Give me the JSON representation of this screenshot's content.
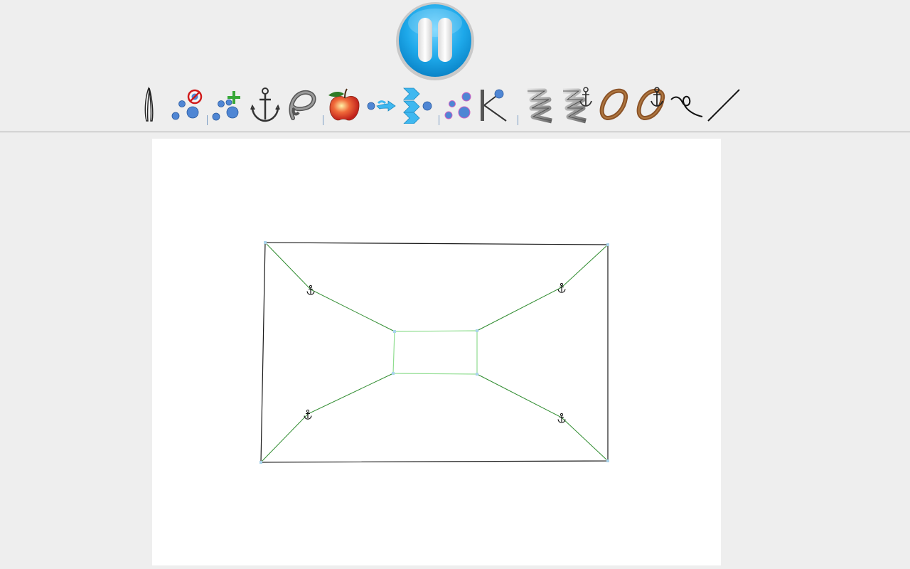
{
  "app": {
    "pause_button": {
      "icon": "pause-icon",
      "state": "running"
    }
  },
  "toolbar": {
    "tools": [
      {
        "id": "tweezers",
        "icon": "tweezers-icon"
      },
      {
        "id": "delete-atom",
        "icon": "delete-atom-icon"
      },
      {
        "id": "add-atom",
        "icon": "add-atom-icon"
      },
      {
        "id": "anchor",
        "icon": "anchor-icon"
      },
      {
        "id": "rope",
        "icon": "rope-icon"
      },
      {
        "id": "apple",
        "icon": "apple-icon"
      },
      {
        "id": "pull",
        "icon": "pull-icon"
      },
      {
        "id": "wind",
        "icon": "wind-icon"
      },
      {
        "id": "molecule",
        "icon": "molecule-icon"
      },
      {
        "id": "bond",
        "icon": "bond-icon"
      },
      {
        "id": "spring",
        "icon": "spring-icon"
      },
      {
        "id": "anchored-spring",
        "icon": "anchored-spring-icon"
      },
      {
        "id": "loop",
        "icon": "loop-icon"
      },
      {
        "id": "anchored-loop",
        "icon": "anchored-loop-icon"
      },
      {
        "id": "string",
        "icon": "string-icon"
      },
      {
        "id": "line",
        "icon": "line-icon"
      }
    ]
  },
  "scene": {
    "outer_frame_color": "#1a1a1a",
    "inner_rect_color": "#8fdd8f",
    "connector_color": "#2e8b2e",
    "node_color": "#aad4ec",
    "anchor_icon": "anchor-icon"
  }
}
